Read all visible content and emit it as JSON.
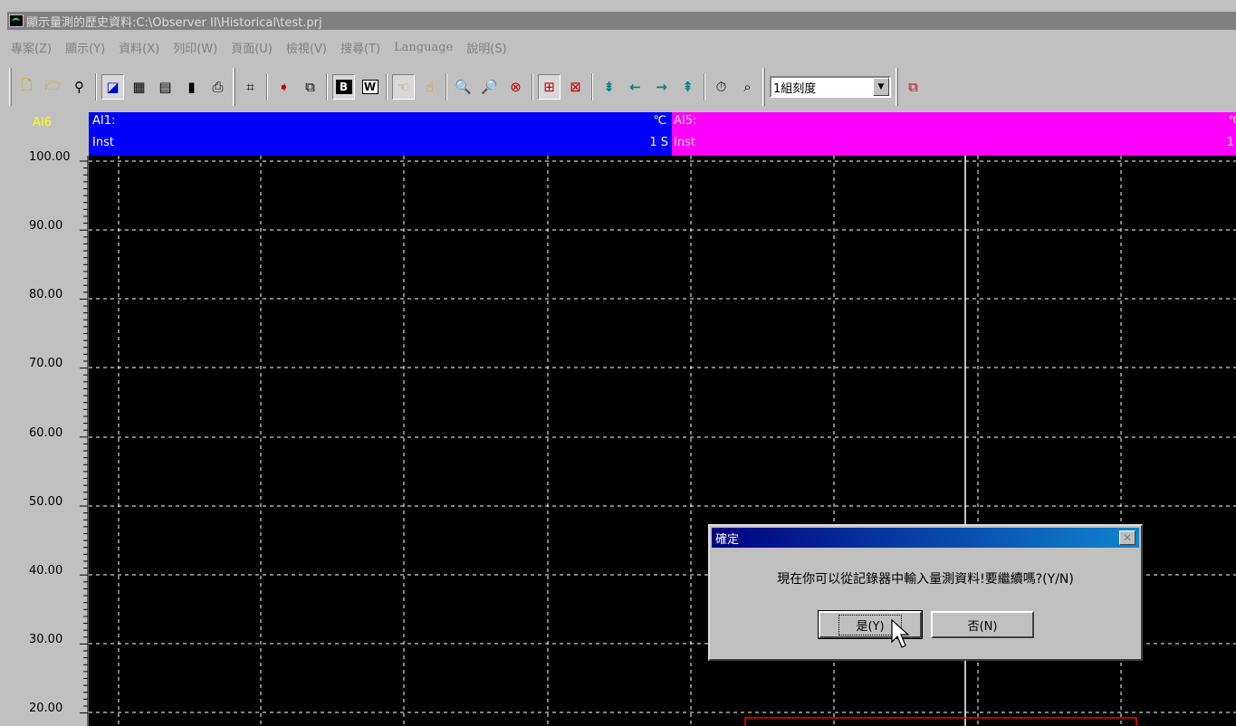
{
  "window": {
    "title": "顯示量測的歷史資料:C:\\Observer II\\Historical\\test.prj"
  },
  "menu": [
    "專案(Z)",
    "顯示(Y)",
    "資料(X)",
    "列印(W)",
    "頁面(U)",
    "檢視(V)",
    "搜尋(T)",
    "Language",
    "說明(S)"
  ],
  "toolbar": {
    "scale_select": "1組刻度"
  },
  "channels": {
    "left_tag": "AI6",
    "a": {
      "name": "AI1:",
      "unit": "℃",
      "mode": "Inst",
      "interval": "1 S"
    },
    "b": {
      "name": "AI5:",
      "unit": "℃",
      "mode": "Inst",
      "interval": "1"
    }
  },
  "y_axis": {
    "ticks": [
      "100.00",
      "90.00",
      "80.00",
      "70.00",
      "60.00",
      "50.00",
      "40.00",
      "30.00",
      "20.00"
    ]
  },
  "dialog": {
    "title": "確定",
    "message": "現在你可以從記錄器中輸入量測資料!要繼續嗎?(Y/N)",
    "yes_label": "是(Y)",
    "no_label": "否(N)"
  },
  "colors": {
    "channel_a": "#0000ff",
    "channel_b": "#ff00ff",
    "plot_bg": "#000000",
    "grid": "#ffffff",
    "box": "#ff0000"
  }
}
